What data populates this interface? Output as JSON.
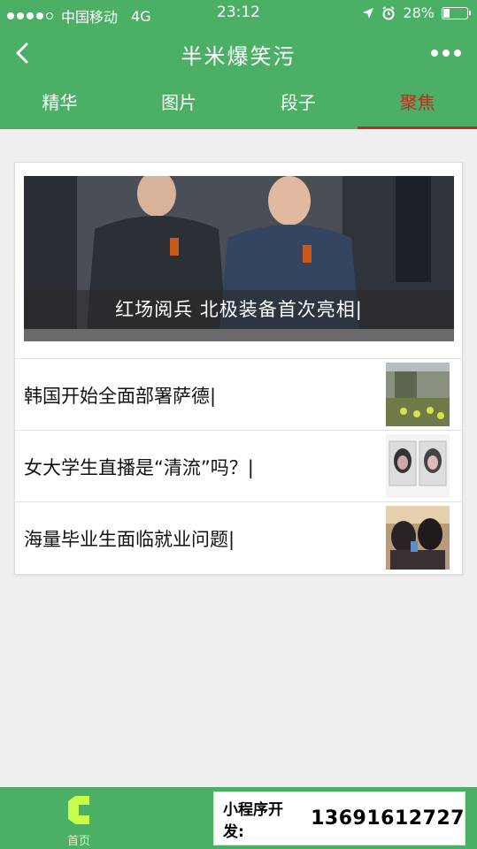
{
  "status_bar": {
    "carrier": "中国移动",
    "network": "4G",
    "time": "23:12",
    "battery": "28%",
    "battery_level": 0.28
  },
  "header": {
    "title": "半米爆笑污"
  },
  "tabs": [
    {
      "label": "精华",
      "active": false
    },
    {
      "label": "图片",
      "active": false
    },
    {
      "label": "段子",
      "active": false
    },
    {
      "label": "聚焦",
      "active": true
    }
  ],
  "feature": {
    "caption": "红场阅兵 北极装备首次亮相|"
  },
  "articles": [
    {
      "title": "韩国开始全面部署萨德|"
    },
    {
      "title": "女大学生直播是“清流”吗？|"
    },
    {
      "title": "海量毕业生面临就业问题|"
    }
  ],
  "bottom_bar": {
    "home_label": "首页"
  },
  "promo": {
    "label": "小程序开发:",
    "phone": "13691612727"
  },
  "colors": {
    "brand_green": "#4caf66",
    "active_tab": "#c8281e"
  }
}
